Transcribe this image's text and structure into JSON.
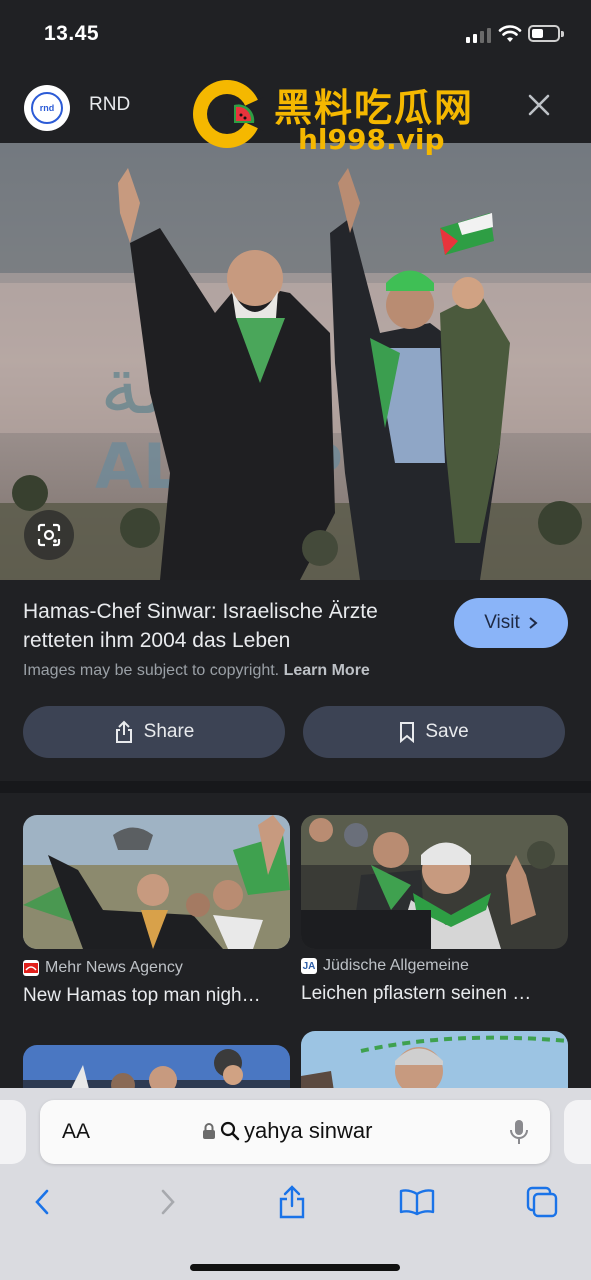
{
  "status_bar": {
    "time": "13.45"
  },
  "header": {
    "source_logo_text": "rnd",
    "source_name": "RND"
  },
  "watermark": {
    "title": "黑料吃瓜网",
    "url": "hl998.vip"
  },
  "result": {
    "title": "Hamas-Chef Sinwar: Israelische Ärzte retteten ihm 2004 das Leben",
    "visit_label": "Visit",
    "copyright_text": "Images may be subject to copyright.",
    "learn_more": "Learn More",
    "share_label": "Share",
    "save_label": "Save"
  },
  "hero_banner_text": "AL  CAP",
  "related": [
    {
      "source": "Mehr News Agency",
      "title": "New Hamas top man nigh…",
      "favicon_color": "#e0201c"
    },
    {
      "source": "Jüdische Allgemeine",
      "title": "Leichen pflastern seinen …",
      "favicon_text": "JA",
      "favicon_color": "#2f5fa8"
    }
  ],
  "browser": {
    "text_size_label": "AA",
    "search_query": "yahya sinwar"
  },
  "colors": {
    "accent": "#8ab4f8",
    "toolbar_icon": "#1a73e8",
    "watermark": "#f5b800"
  }
}
